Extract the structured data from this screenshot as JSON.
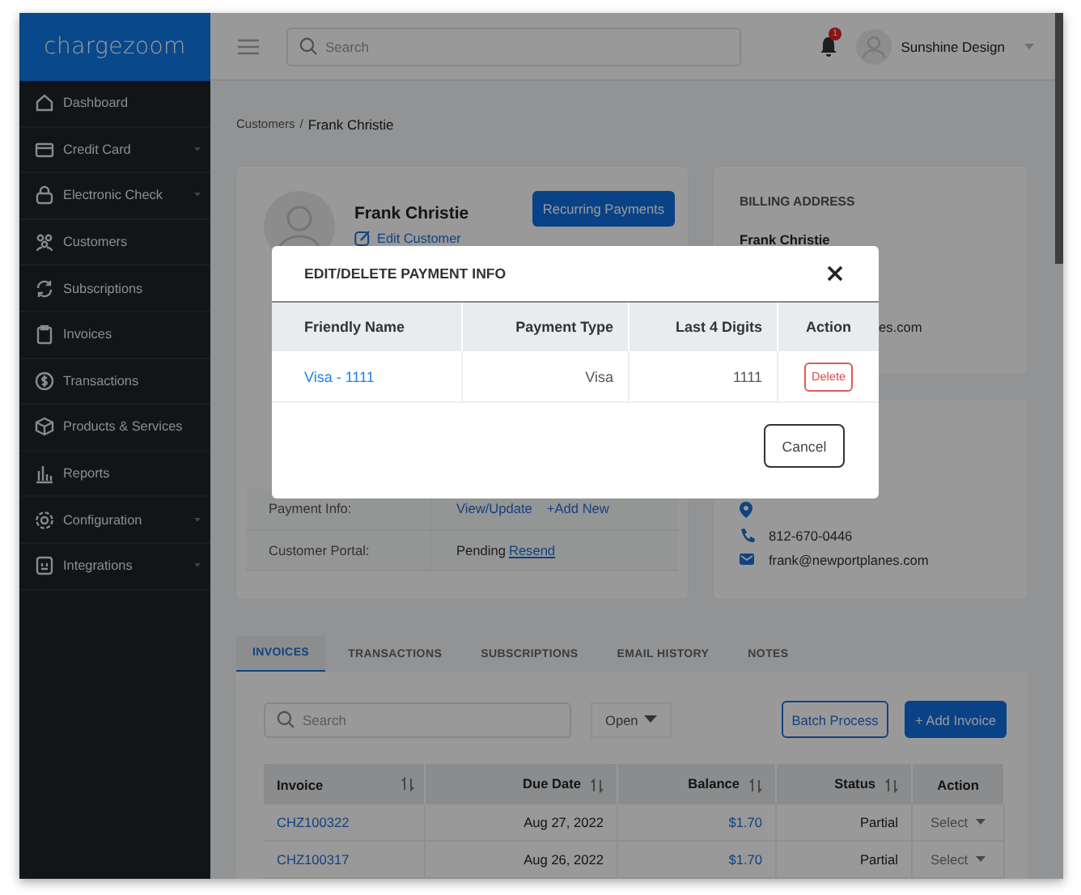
{
  "sidebar": {
    "logo": "chargezoom",
    "items": [
      {
        "label": "Dashboard",
        "expandable": false
      },
      {
        "label": "Credit Card",
        "expandable": true
      },
      {
        "label": "Electronic Check",
        "expandable": true
      },
      {
        "label": "Customers",
        "expandable": false
      },
      {
        "label": "Subscriptions",
        "expandable": false
      },
      {
        "label": "Invoices",
        "expandable": false
      },
      {
        "label": "Transactions",
        "expandable": false
      },
      {
        "label": "Products & Services",
        "expandable": false
      },
      {
        "label": "Reports",
        "expandable": false
      },
      {
        "label": "Configuration",
        "expandable": true
      },
      {
        "label": "Integrations",
        "expandable": true
      }
    ]
  },
  "topbar": {
    "search": {
      "placeholder": "Search"
    },
    "notifications": "1",
    "user": "Sunshine Design"
  },
  "breadcrumb": {
    "parent": "Customers",
    "separator": "/",
    "current": "Frank Christie"
  },
  "profile": {
    "name": "Frank Christie",
    "edit_link": "Edit Customer",
    "button": "Recurring Payments",
    "rows": [
      {
        "label": "Payment Info:",
        "links": [
          "View/Update",
          "+Add New"
        ]
      },
      {
        "label": "Customer Portal:",
        "text": "Pending",
        "links": [
          "Resend"
        ]
      }
    ]
  },
  "billing": {
    "heading": "BILLING ADDRESS",
    "name": "Frank Christie",
    "line_fragment": "es.com"
  },
  "contact": [
    {
      "kind": "location"
    },
    {
      "kind": "phone",
      "text": "812-670-0446"
    },
    {
      "kind": "email",
      "text": "frank@newportplanes.com"
    }
  ],
  "tabs": [
    {
      "label": "INVOICES",
      "selected": true
    },
    {
      "label": "TRANSACTIONS",
      "selected": false
    },
    {
      "label": "SUBSCRIPTIONS",
      "selected": false
    },
    {
      "label": "EMAIL HISTORY",
      "selected": false
    },
    {
      "label": "NOTES",
      "selected": false
    }
  ],
  "invoices": {
    "search": {
      "placeholder": "Search"
    },
    "filter": "Open",
    "batch_button": "Batch Process",
    "add_button": "+ Add Invoice",
    "columns": [
      {
        "label": "Invoice",
        "sortable": true
      },
      {
        "label": "Due Date",
        "sortable": true
      },
      {
        "label": "Balance",
        "sortable": true
      },
      {
        "label": "Status",
        "sortable": true
      },
      {
        "label": "Action",
        "sortable": false
      }
    ],
    "rows": [
      {
        "invoice": "CHZ100322",
        "due_date": "Aug 27, 2022",
        "balance": "$1.70",
        "status": "Partial",
        "action": "Select"
      },
      {
        "invoice": "CHZ100317",
        "due_date": "Aug 26, 2022",
        "balance": "$1.70",
        "status": "Partial",
        "action": "Select"
      }
    ]
  },
  "modal": {
    "title": "EDIT/DELETE PAYMENT INFO",
    "columns": [
      "Friendly Name",
      "Payment Type",
      "Last 4 Digits",
      "Action"
    ],
    "rows": [
      {
        "friendly_name": "Visa - 1111",
        "payment_type": "Visa",
        "last4": "1111",
        "action": "Delete"
      }
    ],
    "cancel": "Cancel"
  }
}
